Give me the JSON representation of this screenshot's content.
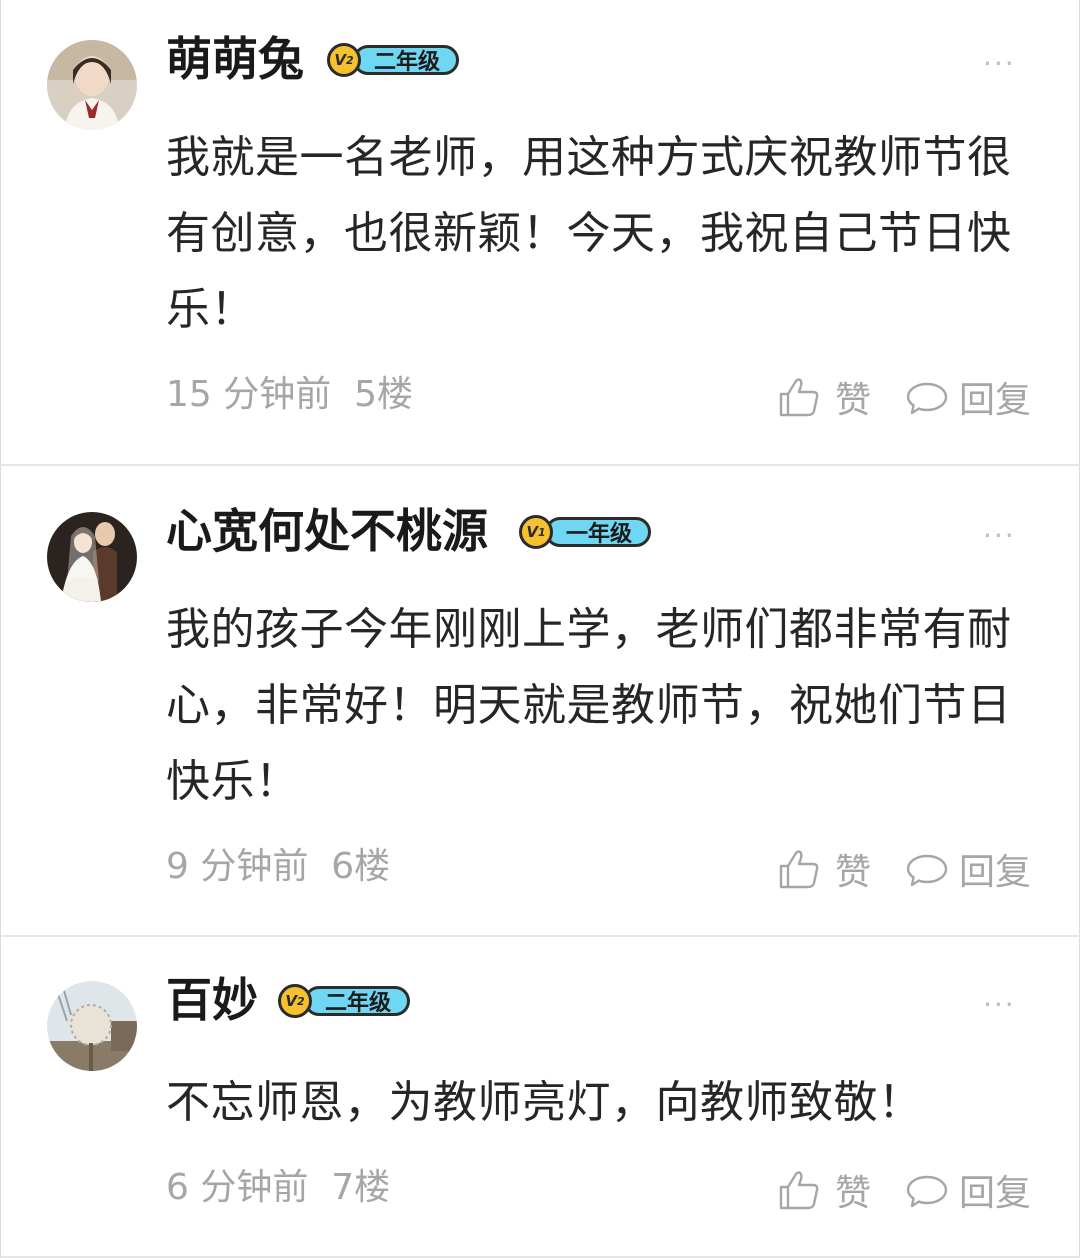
{
  "comments": [
    {
      "username": "萌萌兔",
      "badge_level": "2",
      "badge_label": "二年级",
      "text": "我就是一名老师，用这种方式庆祝教师节很有创意，也很新颖！今天，我祝自己节日快乐！",
      "time": "15 分钟前",
      "floor": "5楼",
      "like_label": "赞",
      "reply_label": "回复",
      "more": "···"
    },
    {
      "username": "心宽何处不桃源",
      "badge_level": "1",
      "badge_label": "一年级",
      "text": "我的孩子今年刚刚上学，老师们都非常有耐心，非常好！明天就是教师节，祝她们节日快乐！",
      "time": "9 分钟前",
      "floor": "6楼",
      "like_label": "赞",
      "reply_label": "回复",
      "more": "···"
    },
    {
      "username": "百妙",
      "badge_level": "2",
      "badge_label": "二年级",
      "text": "不忘师恩，为教师亮灯，向教师致敬！",
      "time": "6 分钟前",
      "floor": "7楼",
      "like_label": "赞",
      "reply_label": "回复",
      "more": "···"
    }
  ],
  "icons": {
    "like": "thumbs-up-icon",
    "reply": "speech-bubble-icon",
    "more": "more-dots-icon"
  },
  "colors": {
    "badge_blue": "#6fd7f2",
    "badge_gold": "#f6c12e",
    "meta_gray": "#a6a6a6"
  }
}
